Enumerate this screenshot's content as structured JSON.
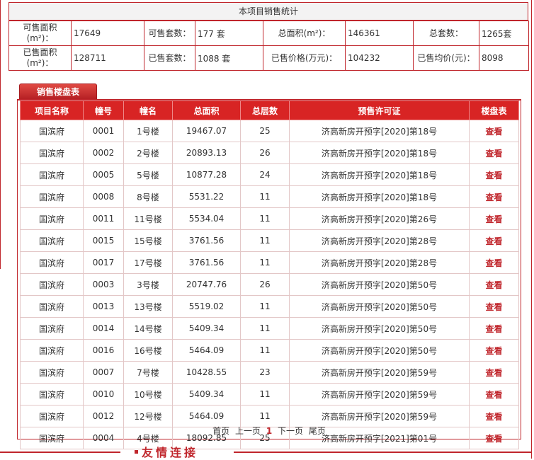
{
  "summary": {
    "title": "本项目销售统计",
    "available_area_label": "可售面积(m²)：",
    "available_area": "17649",
    "available_units_label": "可售套数：",
    "available_units": "177 套",
    "total_area_label": "总面积(m²)：",
    "total_area": "146361",
    "total_units_label": "总套数：",
    "total_units": "1265套",
    "sold_area_label": "已售面积(m²)：",
    "sold_area": "128711",
    "sold_units_label": "已售套数：",
    "sold_units": "1088 套",
    "sold_price_label": "已售价格(万元)：",
    "sold_price": "104232",
    "avg_price_label": "已售均价(元)：",
    "avg_price": "8098"
  },
  "sales_tab": {
    "label": "销售楼盘表"
  },
  "table": {
    "headers": [
      "项目名称",
      "幢号",
      "幢名",
      "总面积",
      "总层数",
      "预售许可证",
      "楼盘表"
    ],
    "view_label": "查看",
    "rows": [
      [
        "国滨府",
        "0001",
        "1号楼",
        "19467.07",
        "25",
        "济高新房开预字[2020]第18号"
      ],
      [
        "国滨府",
        "0002",
        "2号楼",
        "20893.13",
        "26",
        "济高新房开预字[2020]第18号"
      ],
      [
        "国滨府",
        "0005",
        "5号楼",
        "10877.28",
        "24",
        "济高新房开预字[2020]第18号"
      ],
      [
        "国滨府",
        "0008",
        "8号楼",
        "5531.22",
        "11",
        "济高新房开预字[2020]第18号"
      ],
      [
        "国滨府",
        "0011",
        "11号楼",
        "5534.04",
        "11",
        "济高新房开预字[2020]第26号"
      ],
      [
        "国滨府",
        "0015",
        "15号楼",
        "3761.56",
        "11",
        "济高新房开预字[2020]第28号"
      ],
      [
        "国滨府",
        "0017",
        "17号楼",
        "3761.56",
        "11",
        "济高新房开预字[2020]第28号"
      ],
      [
        "国滨府",
        "0003",
        "3号楼",
        "20747.76",
        "26",
        "济高新房开预字[2020]第50号"
      ],
      [
        "国滨府",
        "0013",
        "13号楼",
        "5519.02",
        "11",
        "济高新房开预字[2020]第50号"
      ],
      [
        "国滨府",
        "0014",
        "14号楼",
        "5409.34",
        "11",
        "济高新房开预字[2020]第50号"
      ],
      [
        "国滨府",
        "0016",
        "16号楼",
        "5464.09",
        "11",
        "济高新房开预字[2020]第50号"
      ],
      [
        "国滨府",
        "0007",
        "7号楼",
        "10428.55",
        "23",
        "济高新房开预字[2020]第59号"
      ],
      [
        "国滨府",
        "0010",
        "10号楼",
        "5409.34",
        "11",
        "济高新房开预字[2020]第59号"
      ],
      [
        "国滨府",
        "0012",
        "12号楼",
        "5464.09",
        "11",
        "济高新房开预字[2020]第59号"
      ],
      [
        "国滨府",
        "0004",
        "4号楼",
        "18092.85",
        "25",
        "济高新房开预字[2021]第01号"
      ]
    ]
  },
  "pager": {
    "first": "首页",
    "prev": "上一页",
    "current": "1",
    "next": "下一页",
    "last": "尾页"
  },
  "footer": {
    "friend_links_title": "友情连接"
  },
  "colors": {
    "accent": "#c0262c",
    "header_bg": "#d82424"
  }
}
